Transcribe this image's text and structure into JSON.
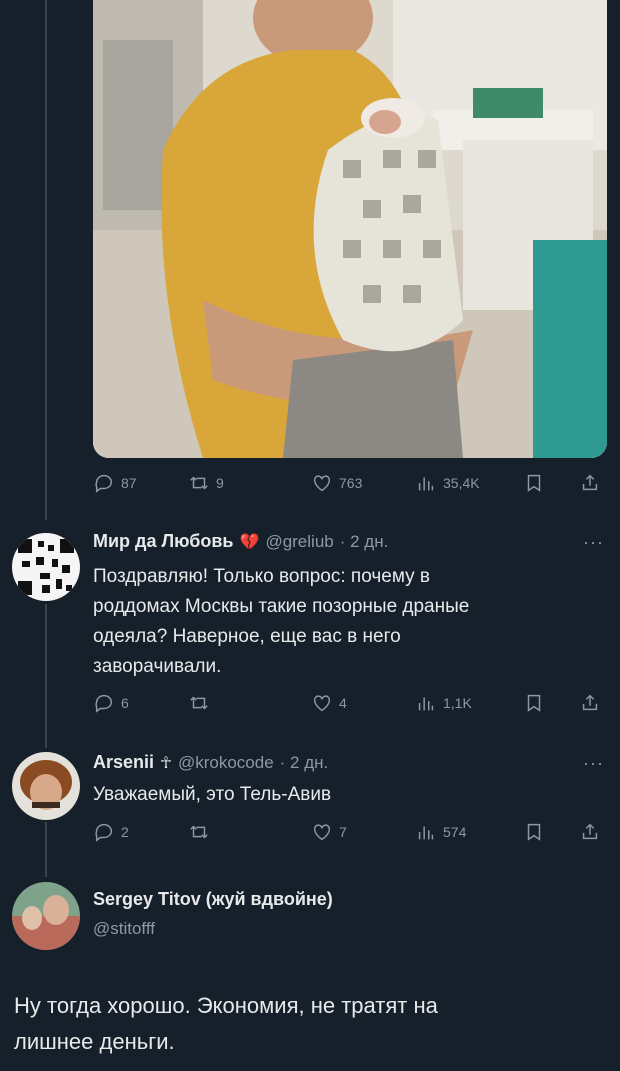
{
  "main_tweet": {
    "photo_alt": "",
    "stats": {
      "replies": "87",
      "retweets": "9",
      "likes": "763",
      "views": "35,4K"
    }
  },
  "replies": [
    {
      "name": "Мир да Любовь",
      "badge": "💔",
      "handle": "@greliub",
      "time": "· 2 дн.",
      "text_lines": [
        "Поздравляю! Только вопрос: почему в",
        "роддомах Москвы такие позорные драные",
        "одеяла? Наверное, еще вас в него",
        "заворачивали."
      ],
      "stats": {
        "replies": "6",
        "retweets": "",
        "likes": "4",
        "views": "1,1K"
      }
    },
    {
      "name": "Arsenii",
      "badge": "☥",
      "handle": "@krokocode",
      "time": "· 2 дн.",
      "text_lines": [
        "Уважаемый, это Тель-Авив"
      ],
      "stats": {
        "replies": "2",
        "retweets": "",
        "likes": "7",
        "views": "574"
      }
    }
  ],
  "focus_tweet": {
    "name": "Sergey Titov (жуй вдвойне)",
    "handle": "@stitofff",
    "text_lines": [
      "Ну тогда хорошо. Экономия, не тратят на",
      "лишнее деньги."
    ]
  },
  "more_label": "···",
  "colors": {
    "bg": "#15202b",
    "text": "#e7e9ea",
    "muted": "#8b98a5",
    "line": "#38444d"
  }
}
